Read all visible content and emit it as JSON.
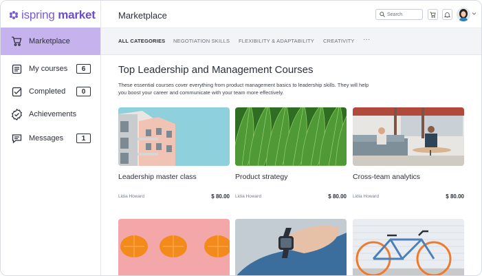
{
  "brand": {
    "name_light": "ispring",
    "name_bold": " market",
    "accent": "#7a5bd3"
  },
  "sidebar": {
    "items": [
      {
        "label": "Marketplace",
        "icon": "cart-icon",
        "count": null,
        "active": true
      },
      {
        "label": "My courses",
        "icon": "courses-icon",
        "count": "6"
      },
      {
        "label": "Completed",
        "icon": "checkbox-icon",
        "count": "0"
      },
      {
        "label": "Achievements",
        "icon": "badge-icon",
        "count": null
      },
      {
        "label": "Messages",
        "icon": "message-icon",
        "count": "1"
      }
    ]
  },
  "header": {
    "title": "Marketplace",
    "search_placeholder": "Search"
  },
  "tabs": [
    {
      "label": "ALL CATEGORIES",
      "active": true
    },
    {
      "label": "NEGOTIATION SKILLS"
    },
    {
      "label": "FLEXIBILITY & ADAPTABILITY"
    },
    {
      "label": "CREATIVITY"
    },
    {
      "label": "···"
    }
  ],
  "main": {
    "heading": "Top Leadership and Management Courses",
    "description": "These essential courses cover everything from product management basics to leadership skills. They will help you boost your career and communicate with your team more effectively."
  },
  "courses": [
    {
      "title": "Leadership master class",
      "author": "Lidia Howard",
      "price": "$ 80.00"
    },
    {
      "title": "Product strategy",
      "author": "Lidia Howard",
      "price": "$ 80.00"
    },
    {
      "title": "Cross-team analytics",
      "author": "Lidia Howard",
      "price": "$ 80.00"
    }
  ]
}
